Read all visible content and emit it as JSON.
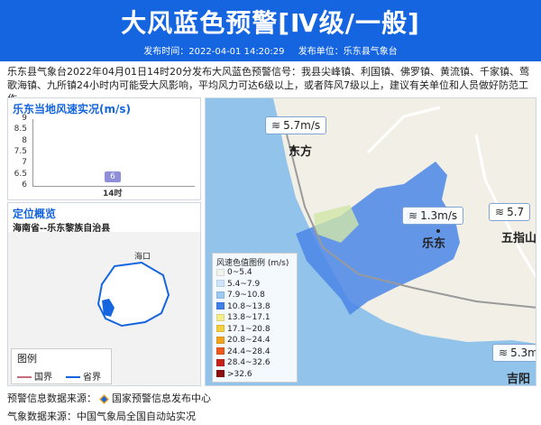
{
  "header": {
    "title": "大风蓝色预警[Ⅳ级/一般]",
    "publish_time": "发布时间：2022-04-01 14:20:29",
    "publisher": "发布单位：乐东县气象台"
  },
  "description": "乐东县气象台2022年04月01日14时20分发布大风蓝色预警信号：我县尖峰镇、利国镇、佛罗镇、黄流镇、千家镇、莺歌海镇、九所镇24小时内可能受大风影响，平均风力可达6级以上，或者阵风7级以上，建议有关单位和人员做好防范工作。",
  "wind_panel": {
    "title": "乐东当地风速实况(m/s)"
  },
  "chart_data": {
    "type": "bar",
    "categories": [
      "14时"
    ],
    "values": [
      6
    ],
    "data_labels": [
      "6"
    ],
    "title": "乐东当地风速实况(m/s)",
    "y_ticks": [
      "9",
      "8.5",
      "8",
      "7.5",
      "7",
      "6.5",
      "6"
    ],
    "ylim": [
      6,
      9
    ]
  },
  "location_panel": {
    "title": "定位概览",
    "subtitle": "海南省--乐东黎族自治县",
    "map_label": "海口",
    "legend": {
      "title": "图例",
      "items": [
        {
          "label": "国界",
          "color": "#c76b7a"
        },
        {
          "label": "省界",
          "color": "#1565e0"
        }
      ]
    }
  },
  "map": {
    "wind_labels": [
      {
        "value": "5.7m/s"
      },
      {
        "value": "1.3m/s"
      },
      {
        "value": "5.7"
      },
      {
        "value": "5.3m"
      }
    ],
    "cities": [
      "东方",
      "乐东",
      "五指山",
      "吉阳"
    ],
    "scale": {
      "title": "风速色值图例 (m/s)",
      "rows": [
        {
          "label": "0~5.4",
          "color": "#f3f3ee"
        },
        {
          "label": "5.4~7.9",
          "color": "#cfe6fa"
        },
        {
          "label": "7.9~10.8",
          "color": "#9ccaf2"
        },
        {
          "label": "10.8~13.8",
          "color": "#3f7fea"
        },
        {
          "label": "13.8~17.1",
          "color": "#f6ec88"
        },
        {
          "label": "17.1~20.8",
          "color": "#f5cf3c"
        },
        {
          "label": "20.8~24.4",
          "color": "#f3a41e"
        },
        {
          "label": "24.4~28.4",
          "color": "#ec5a1c"
        },
        {
          "label": "28.4~32.6",
          "color": "#c7231a"
        },
        {
          "label": ">32.6",
          "color": "#8b0f0f"
        }
      ]
    }
  },
  "footer": {
    "warning_source_label": "预警信息数据来源：",
    "warning_source": "国家预警信息发布中心",
    "weather_source": "气象数据来源：中国气象局全国自动站实况"
  }
}
